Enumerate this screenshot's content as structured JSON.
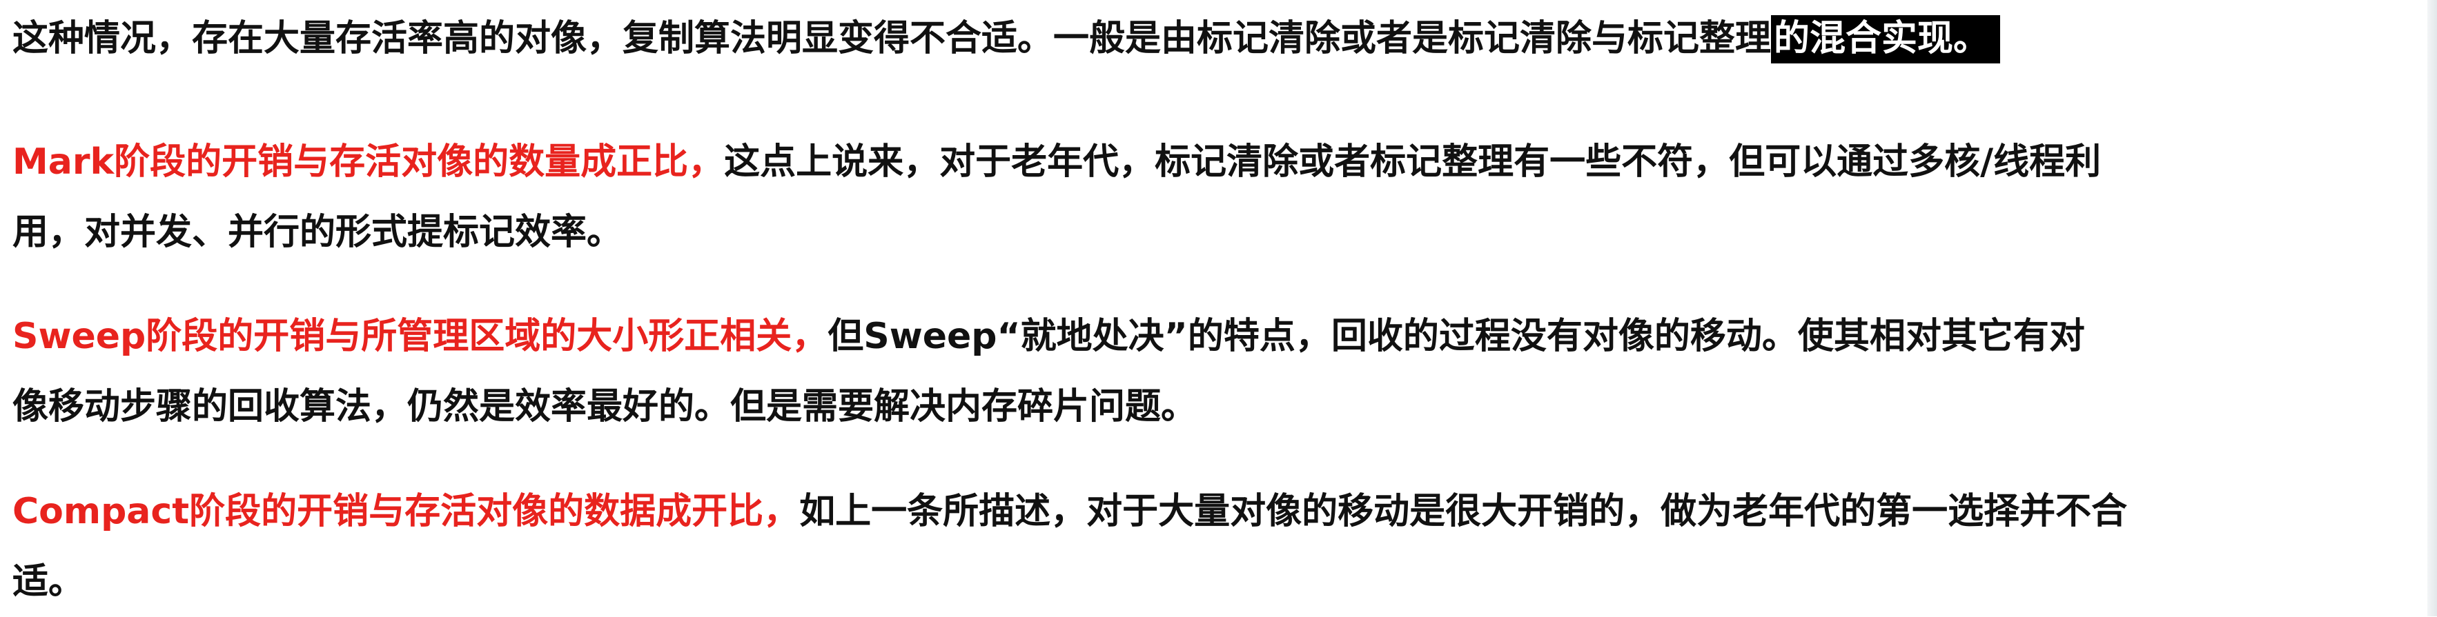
{
  "paragraphs": [
    {
      "lines": [
        {
          "plain": "这种情况，存在大量存活率高的对像，复制算法明显变得不合适。一般是由标记清除或者是标记清除与标记整理",
          "highlight": "的混合实现。"
        }
      ]
    },
    {
      "red": "Mark阶段的开销与存活对像的数量成正比，",
      "lines": [
        "这点上说来，对于老年代，标记清除或者标记整理有一些不符，但可以通过多核/线程利",
        "用，对并发、并行的形式提标记效率。"
      ]
    },
    {
      "red": "Sweep阶段的开销与所管理区域的大小形正相关，",
      "lines": [
        "但Sweep“就地处决”的特点，回收的过程没有对像的移动。使其相对其它有对",
        "像移动步骤的回收算法，仍然是效率最好的。但是需要解决内存碎片问题。"
      ]
    },
    {
      "red": "Compact阶段的开销与存活对像的数据成开比，",
      "lines": [
        "如上一条所描述，对于大量对像的移动是很大开销的，做为老年代的第一选择并不合",
        "适。"
      ]
    }
  ],
  "colors": {
    "text": "#111111",
    "accent_red": "#e8231e",
    "highlight_bg": "#000000",
    "highlight_fg": "#ffffff",
    "background": "#ffffff"
  }
}
